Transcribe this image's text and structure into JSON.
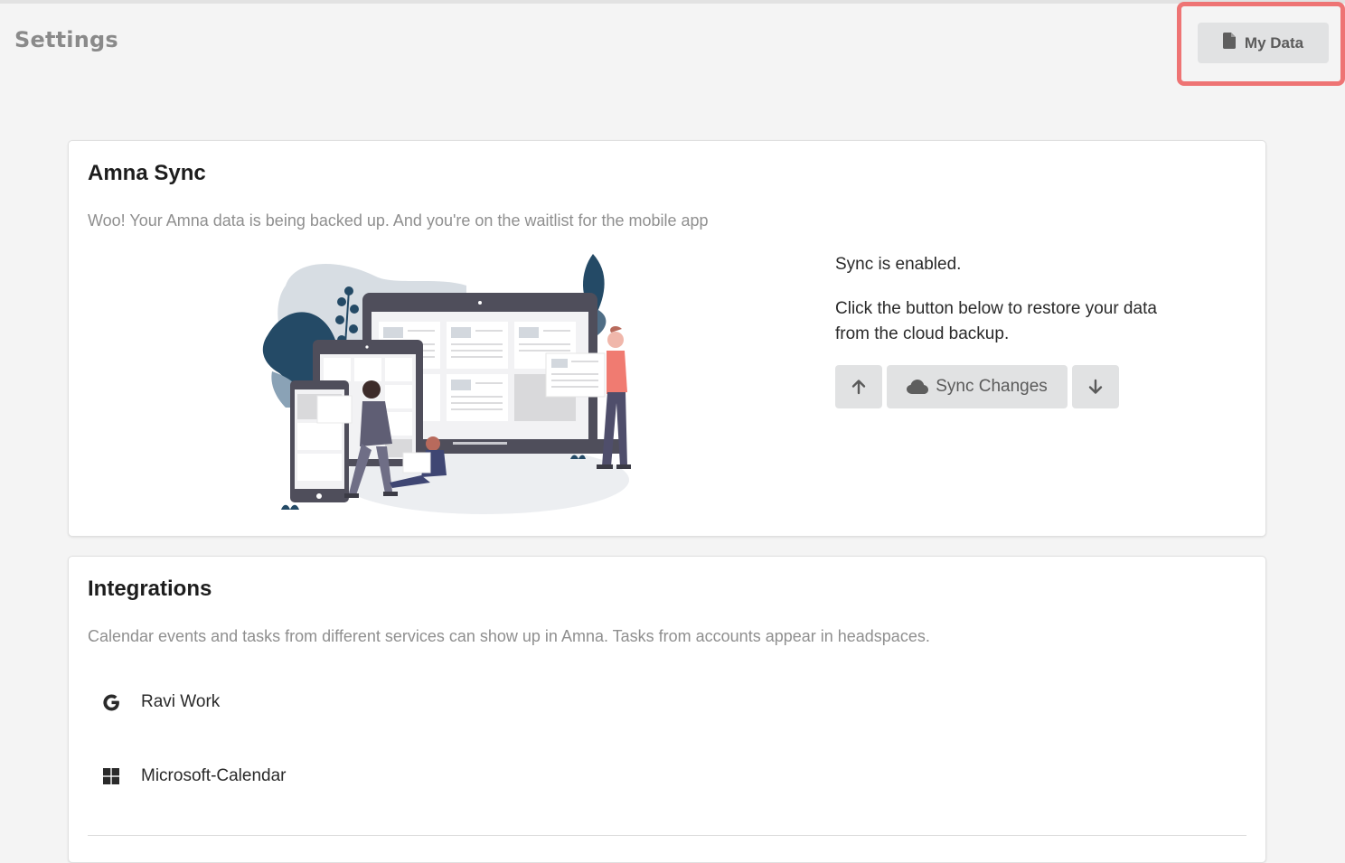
{
  "header": {
    "title": "Settings",
    "my_data_button": {
      "label": "My Data",
      "icon": "document-icon"
    },
    "highlight_color": "#ee7474"
  },
  "sync_card": {
    "title": "Amna Sync",
    "description": "Woo! Your Amna data is being backed up. And you're on the waitlist for the mobile app",
    "status": "Sync is enabled.",
    "help_text": "Click the button below to restore your data from the cloud backup.",
    "buttons": {
      "upload": {
        "icon": "arrow-up-icon"
      },
      "sync": {
        "label": "Sync Changes",
        "icon": "cloud-icon"
      },
      "download": {
        "icon": "arrow-down-icon"
      }
    },
    "illustration": "devices-and-people-illustration"
  },
  "integrations_card": {
    "title": "Integrations",
    "description": "Calendar events and tasks from different services can show up in Amna. Tasks from accounts appear in headspaces.",
    "items": [
      {
        "label": "Ravi Work",
        "icon": "google-icon"
      },
      {
        "label": "Microsoft-Calendar",
        "icon": "windows-icon"
      }
    ]
  },
  "colors": {
    "background": "#f4f4f4",
    "card": "#ffffff",
    "button_bg": "#e1e2e3",
    "accent_dark_teal": "#244a66",
    "person_red": "#f07b71"
  }
}
